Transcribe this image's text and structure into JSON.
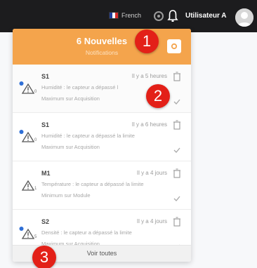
{
  "topbar": {
    "language": "French",
    "user_name": "Utilisateur A"
  },
  "panel": {
    "title": "6 Nouvelles",
    "subtitle": "Notifications",
    "see_all": "Voir toutes",
    "notifications": [
      {
        "code": "S1",
        "time": "Il y a 5 heures",
        "message": "Humidité : le capteur a dépassé l",
        "detail": "Maximum sur Acquisition",
        "badge": "0"
      },
      {
        "code": "S1",
        "time": "Il y a 6 heures",
        "message": "Humidité : le capteur a dépassé la limite",
        "detail": "Maximum sur Acquisition",
        "badge": "0"
      },
      {
        "code": "M1",
        "time": "Il y a 4 jours",
        "message": "Température : le capteur a dépassé la limite",
        "detail": "Minimum sur Module",
        "badge": "1"
      },
      {
        "code": "S2",
        "time": "Il y a 4 jours",
        "message": "Densité : le capteur a dépassé la limite",
        "detail": "Maximum sur Acquisition",
        "badge": "5"
      }
    ]
  },
  "markers": [
    "1",
    "2",
    "3"
  ],
  "colors": {
    "topbar": "#1c1c1e",
    "header": "#f4a44c",
    "marker": "#e32018",
    "dot": "#2f6fd6"
  }
}
